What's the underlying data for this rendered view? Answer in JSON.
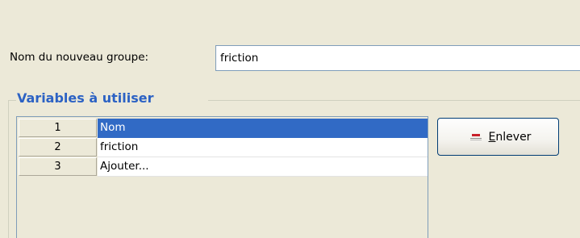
{
  "form": {
    "name_label": "Nom du nouveau groupe:",
    "name_value": "friction"
  },
  "group": {
    "title": "Variables à utiliser"
  },
  "table": {
    "rows": [
      {
        "num": "1",
        "value": "Nom",
        "selected": true
      },
      {
        "num": "2",
        "value": "friction",
        "selected": false
      },
      {
        "num": "3",
        "value": "Ajouter...",
        "selected": false
      }
    ]
  },
  "buttons": {
    "remove_mnemonic": "E",
    "remove_rest": "nlever",
    "remove_icon": "remove-icon"
  },
  "colors": {
    "background": "#ece9d8",
    "selection": "#316ac5",
    "group_title": "#2c62c4",
    "remove_icon_red": "#c8202a"
  }
}
